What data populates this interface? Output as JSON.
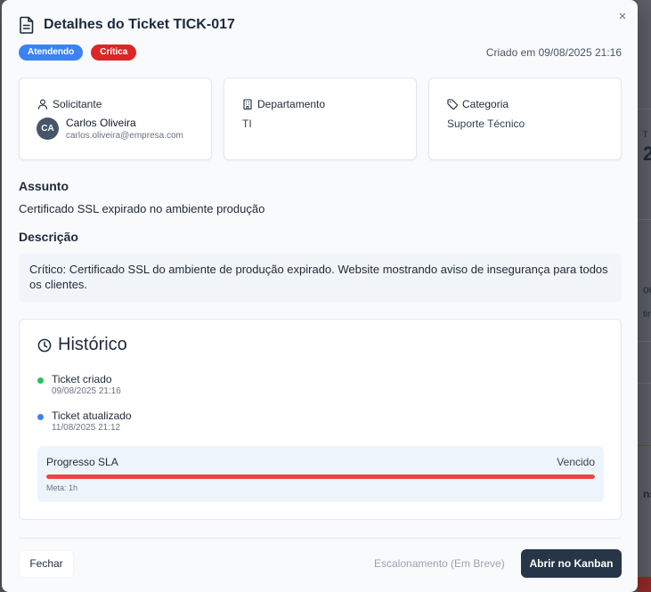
{
  "modal": {
    "title": "Detalhes do Ticket TICK-017",
    "close_symbol": "×",
    "badges": [
      {
        "label": "Atendendo",
        "color": "#3b82f6"
      },
      {
        "label": "Crítica",
        "color": "#dc2626"
      }
    ],
    "created": "Criado em 09/08/2025 21:16"
  },
  "cards": {
    "requester": {
      "label": "Solicitante",
      "initials": "CA",
      "name": "Carlos Oliveira",
      "email": "carlos.oliveira@empresa.com"
    },
    "department": {
      "label": "Departamento",
      "value": "TI"
    },
    "category": {
      "label": "Categoria",
      "value": "Suporte Técnico"
    }
  },
  "subject": {
    "heading": "Assunto",
    "text": "Certificado SSL expirado no ambiente produção"
  },
  "description": {
    "heading": "Descrição",
    "text": "Crítico: Certificado SSL do ambiente de produção expirado. Website mostrando aviso de insegurança para todos os clientes."
  },
  "history": {
    "heading": "Histórico",
    "events": [
      {
        "title": "Ticket criado",
        "time": "09/08/2025 21:16",
        "color": "#22c55e"
      },
      {
        "title": "Ticket atualizado",
        "time": "11/08/2025 21:12",
        "color": "#3b82f6"
      }
    ],
    "sla": {
      "label": "Progresso SLA",
      "status": "Vencido",
      "progress_percent": 100,
      "meta": "Meta: 1h",
      "color": "#ef4444"
    }
  },
  "footer": {
    "close_label": "Fechar",
    "escalate_label": "Escalonamento (Em Breve)",
    "kanban_label": "Abrir no Kanban"
  },
  "background": {
    "fragments": [
      "T",
      "2",
      "od",
      "tin",
      "ns"
    ]
  },
  "icons": {
    "title_icon": "document-icon",
    "requester_icon": "user-icon",
    "department_icon": "building-icon",
    "category_icon": "tag-icon",
    "history_icon": "clock-icon"
  }
}
